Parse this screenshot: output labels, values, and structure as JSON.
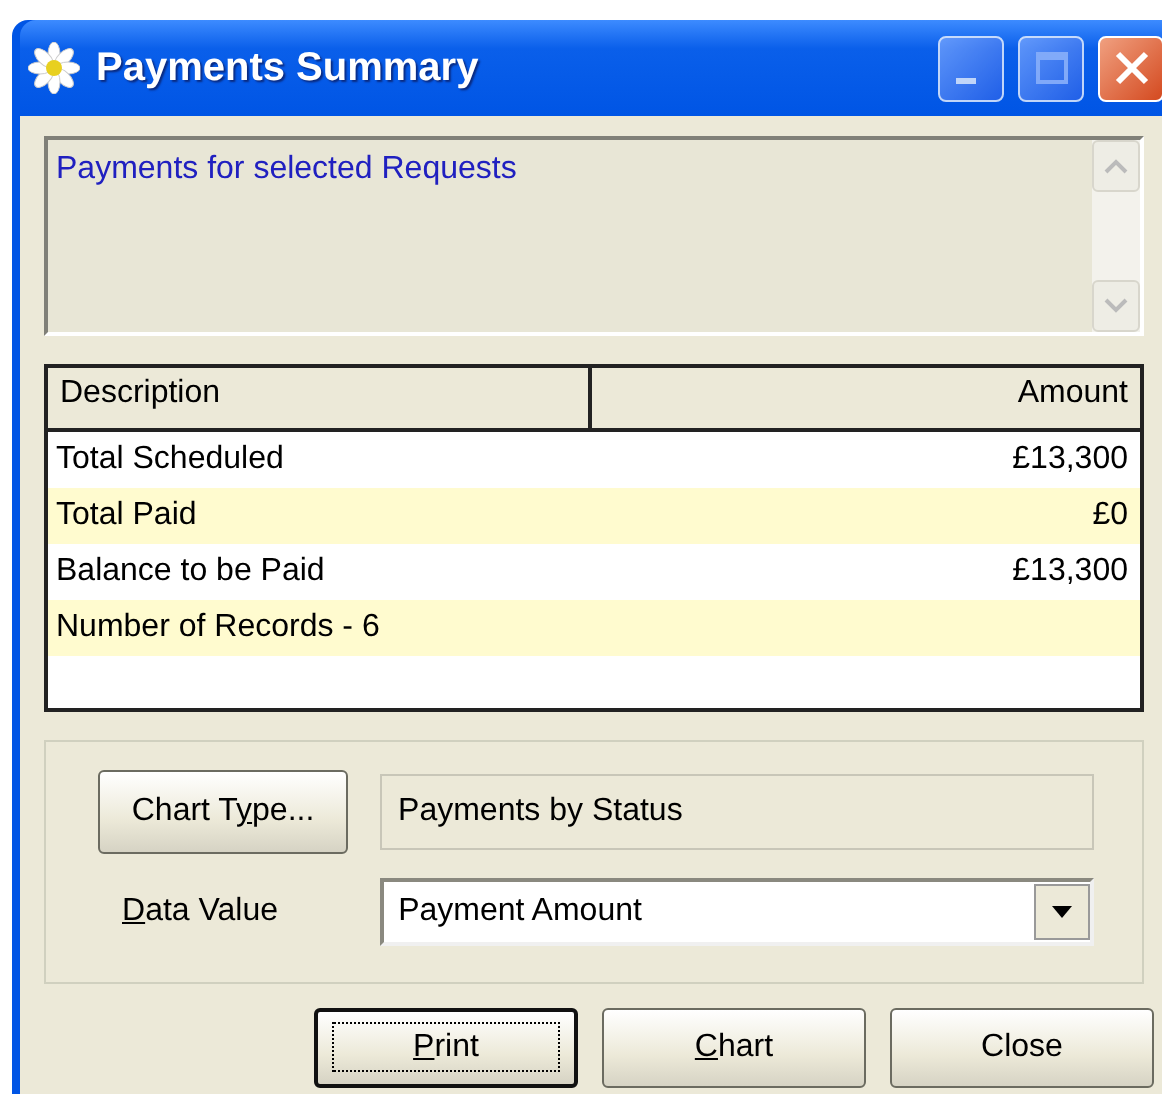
{
  "window": {
    "title": "Payments Summary"
  },
  "description": {
    "text": "Payments for selected Requests"
  },
  "table": {
    "columns": [
      {
        "label": "Description"
      },
      {
        "label": "Amount"
      }
    ],
    "rows": [
      {
        "description": "Total Scheduled",
        "amount": "£13,300"
      },
      {
        "description": "Total Paid",
        "amount": "£0"
      },
      {
        "description": "Balance to be Paid",
        "amount": "£13,300"
      },
      {
        "description": "Number of Records  -  6"
      }
    ]
  },
  "chart_type": {
    "button": {
      "label_parts": [
        {
          "text": "Chart T",
          "underlined": false
        },
        {
          "text": "y",
          "underlined": true
        },
        {
          "text": "pe...",
          "underlined": false
        }
      ]
    },
    "value": "Payments by Status"
  },
  "data_value": {
    "label_parts": [
      {
        "text": "D",
        "underlined": true
      },
      {
        "text": "ata Value",
        "underlined": false
      }
    ],
    "value": "Payment Amount"
  },
  "buttons": [
    {
      "label_parts": [
        {
          "text": "P",
          "underlined": true
        },
        {
          "text": "rint",
          "underlined": false
        }
      ],
      "default": true
    },
    {
      "label_parts": [
        {
          "text": "C",
          "underlined": true
        },
        {
          "text": "hart",
          "underlined": false
        }
      ],
      "default": false
    },
    {
      "label_parts": [
        {
          "text": "Close",
          "underlined": false
        }
      ],
      "default": false
    }
  ]
}
